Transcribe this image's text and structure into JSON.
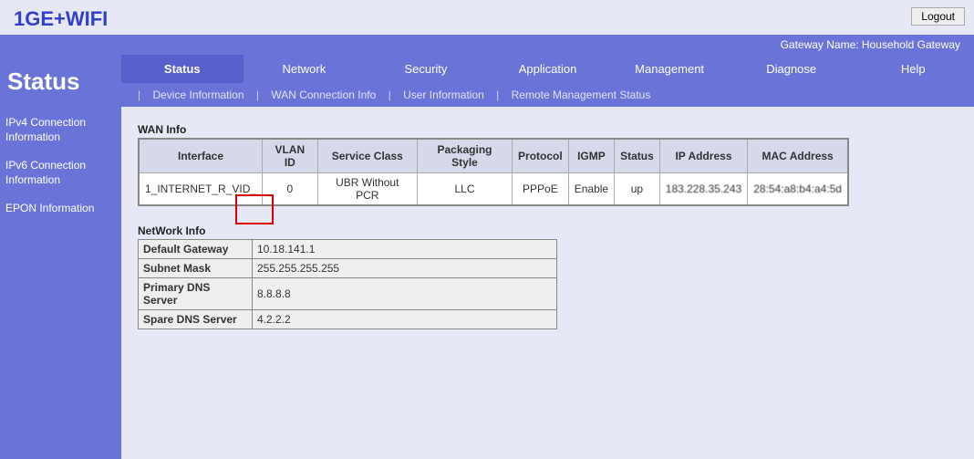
{
  "brand": "1GE+WIFI",
  "logout": "Logout",
  "gateway_label": "Gateway Name: Household Gateway",
  "sidebar": {
    "title": "Status",
    "links": {
      "ipv4": "IPv4 Connection Information",
      "ipv6": "IPv6 Connection Information",
      "epon": "EPON Information"
    }
  },
  "topnav": {
    "status": "Status",
    "network": "Network",
    "security": "Security",
    "application": "Application",
    "management": "Management",
    "diagnose": "Diagnose",
    "help": "Help"
  },
  "subnav": {
    "device": "Device Information",
    "wan": "WAN Connection Info",
    "user": "User Information",
    "remote": "Remote Management Status"
  },
  "wan_info": {
    "label": "WAN Info",
    "headers": {
      "interface": "Interface",
      "vlan": "VLAN ID",
      "service": "Service Class",
      "packaging": "Packaging Style",
      "protocol": "Protocol",
      "igmp": "IGMP",
      "status": "Status",
      "ip": "IP Address",
      "mac": "MAC Address"
    },
    "row": {
      "interface": "1_INTERNET_R_VID_",
      "vlan": "0",
      "service": "UBR Without PCR",
      "packaging": "LLC",
      "protocol": "PPPoE",
      "igmp": "Enable",
      "status": "up",
      "ip": "183.228.35.243",
      "mac": "28:54:a8:b4:a4:5d"
    }
  },
  "net_info": {
    "label": "NetWork Info",
    "rows": {
      "gateway_l": "Default Gateway",
      "gateway_v": "10.18.141.1",
      "subnet_l": "Subnet Mask",
      "subnet_v": "255.255.255.255",
      "pdns_l": "Primary DNS Server",
      "pdns_v": "8.8.8.8",
      "sdns_l": "Spare DNS Server",
      "sdns_v": "4.2.2.2"
    }
  }
}
